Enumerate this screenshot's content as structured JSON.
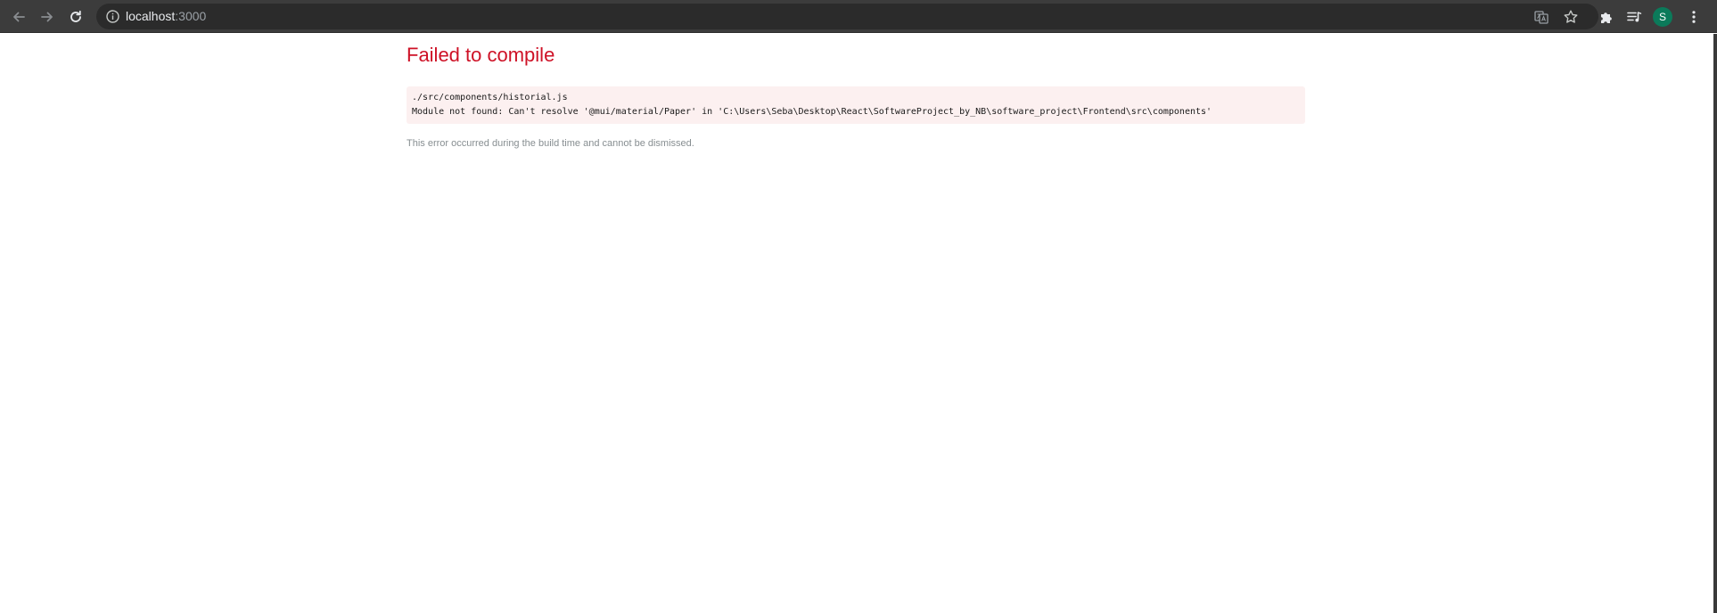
{
  "browser": {
    "url_host": "localhost",
    "url_port": ":3000",
    "profile_initial": "S",
    "icons": {
      "back": "arrow-left-icon",
      "forward": "arrow-right-icon",
      "reload": "reload-icon",
      "site_info": "info-icon",
      "translate": "translate-icon",
      "bookmark": "star-icon",
      "extensions": "puzzle-icon",
      "reading_list": "media-queue-icon",
      "menu": "kebab-menu-icon"
    },
    "colors": {
      "toolbar": "#3c3c3c",
      "omnibox": "#2b2b2b",
      "avatar": "#0b7a5a"
    }
  },
  "error": {
    "title": "Failed to compile",
    "file": "./src/components/historial.js",
    "message": "Module not found: Can't resolve '@mui/material/Paper' in 'C:\\Users\\Seba\\Desktop\\React\\SoftwareProject_by_NB\\software_project\\Frontend\\src\\components'",
    "note": "This error occurred during the build time and cannot be dismissed.",
    "colors": {
      "title": "#ce1126",
      "box_background": "#fcf0f0",
      "note": "#878e91"
    }
  }
}
